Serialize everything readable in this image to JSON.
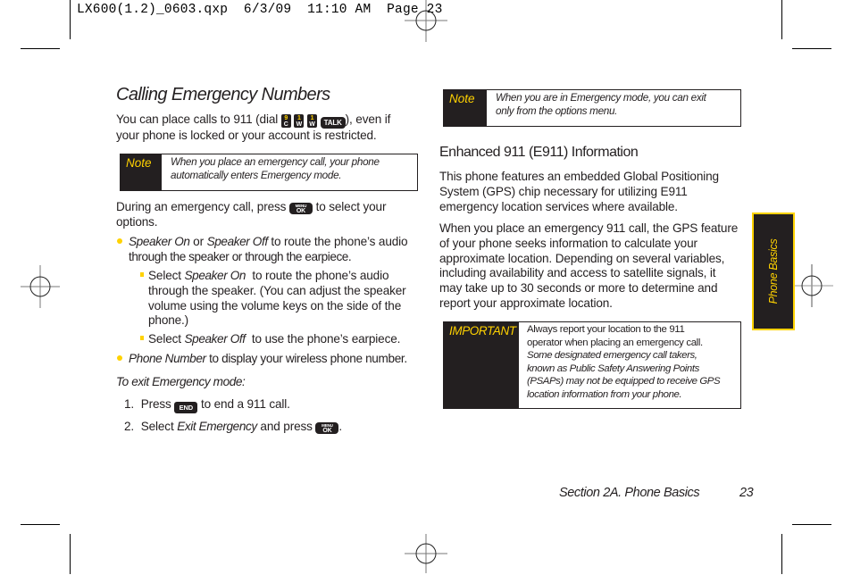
{
  "slug": "LX600(1.2)_0603.qxp  6/3/09  11:10 AM  Page 23",
  "left": {
    "title": "Calling Emergency Numbers",
    "intro_before": "You can place calls to 911 (dial",
    "intro_after": "), even if",
    "intro_line2": "your phone is locked or your account is restricted.",
    "dial_keys": [
      {
        "top": "9",
        "sub": "C"
      },
      {
        "top": "1",
        "sub": "W"
      },
      {
        "top": "1",
        "sub": "W"
      }
    ],
    "talk_key": "TALK",
    "note1": {
      "label": "Note",
      "line1": "When you place an emergency call, your phone",
      "line2": "automatically enters Emergency mode."
    },
    "during_before": "During an emergency call, press",
    "during_after": "to select your",
    "during_line2": "options.",
    "ok_key_top": "MENU",
    "ok_key_bottom": "OK",
    "bullet1": {
      "it1": "Speaker On",
      "mid": " or ",
      "it2": "Speaker Off",
      "rest": " to route the phone’s audio",
      "line2": "through the speaker or through the earpiece."
    },
    "sub1": {
      "pre": "Select ",
      "it": "Speaker On",
      "rest": "  to route the phone’s audio",
      "line2": "through the speaker. (You can adjust the speaker",
      "line3": "volume using the volume keys on the side of the",
      "line4": "phone.)"
    },
    "sub2": {
      "pre": "Select ",
      "it": "Speaker Off",
      "rest": "  to use the phone’s earpiece."
    },
    "bullet2": {
      "it": "Phone Number",
      "rest": " to display your wireless phone number."
    },
    "exit_heading": "To exit Emergency mode:",
    "steps": [
      {
        "num": "1.",
        "pre": "Press",
        "key": "END",
        "rest": "to end a 911 call."
      },
      {
        "num": "2.",
        "pre": "Select ",
        "it": "Exit Emergency",
        "mid": " and press",
        "end": "."
      }
    ]
  },
  "right": {
    "note2": {
      "label": "Note",
      "line1": "When you are in Emergency mode, you can exit",
      "line2": "only from the options menu."
    },
    "subtitle": "Enhanced 911 (E911) Information",
    "para1": [
      "This phone features an embedded Global Positioning",
      "System (GPS) chip necessary for utilizing E911",
      "emergency location services where available."
    ],
    "para2": [
      "When you place an emergency 911 call, the GPS feature",
      "of your phone seeks information to calculate your",
      "approximate location. Depending on several variables,",
      "including availability and access to satellite signals, it",
      "may take up to 30 seconds or more to determine and",
      "report your approximate location."
    ],
    "important": {
      "label": "IMPORTANT",
      "lines_regular": [
        "Always report your location to the 911",
        "operator when placing an emergency call."
      ],
      "lines_italic": [
        "Some designated emergency call takers,",
        "known as Public Safety Answering Points",
        "(PSAPs) may not be equipped to receive GPS",
        "location information from your phone."
      ]
    }
  },
  "side_tab": "Phone Basics",
  "footer": {
    "section": "Section 2A. Phone Basics",
    "page": "23"
  },
  "colors": {
    "accent_yellow": "#ffd200",
    "text_dark": "#231f20"
  }
}
